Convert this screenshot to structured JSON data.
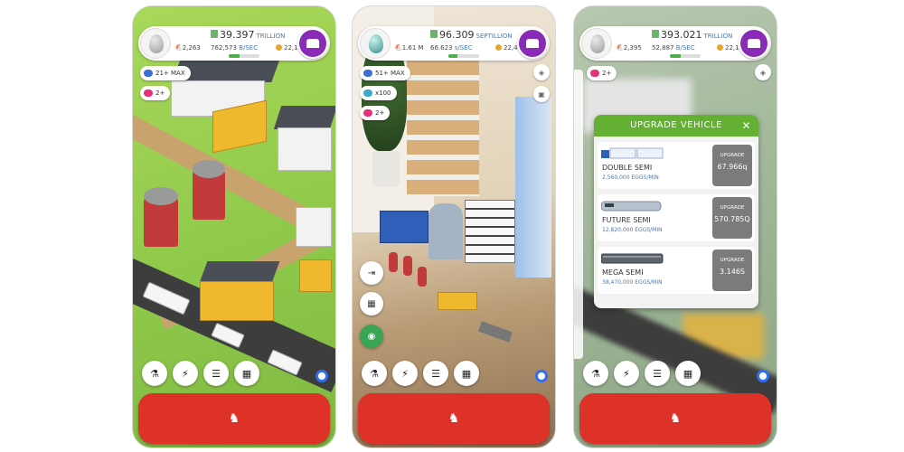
{
  "screens": [
    {
      "money": "39.397",
      "money_unit": "TRILLION",
      "chickens": "2,263",
      "rate": "762,573",
      "rate_unit": "B/SEC",
      "golden_eggs": "22,191",
      "progress": 0.35,
      "pills": [
        "21+ MAX",
        "2+"
      ]
    },
    {
      "money": "96.309",
      "money_unit": "SEPTILLION",
      "chickens": "1.61 M",
      "rate": "66.623",
      "rate_unit": "s/SEC",
      "golden_eggs": "22,479",
      "progress": 0.3,
      "pills": [
        "51+ MAX",
        "x100",
        "2+"
      ]
    },
    {
      "money": "393.021",
      "money_unit": "TRILLION",
      "chickens": "2,395",
      "rate": "52,887",
      "rate_unit": "B/SEC",
      "golden_eggs": "22,191",
      "progress": 0.35,
      "pills": [
        "2+"
      ]
    }
  ],
  "upgrade_panel": {
    "title": "UPGRADE VEHICLE",
    "close": "✕",
    "button_label": "UPGRADE",
    "vehicles": [
      {
        "name": "DOUBLE SEMI",
        "rate": "2,560,000 EGGS/MIN",
        "price": "67.966q"
      },
      {
        "name": "FUTURE SEMI",
        "rate": "12,820,000 EGGS/MIN",
        "price": "570.785Q"
      },
      {
        "name": "MEGA SEMI",
        "rate": "38,470,000 EGGS/MIN",
        "price": "3.146S"
      }
    ]
  },
  "icons": {
    "bottom_bar": [
      "flask-icon",
      "bolt-icon",
      "list-icon",
      "grid-icon"
    ],
    "hatch": "chicken-icon",
    "side_buttons": [
      "exit-icon",
      "grid-icon",
      "vr-headset-icon"
    ]
  },
  "colors": {
    "hatch_red": "#de3127",
    "shop_purple": "#8a2bb8",
    "panel_green": "#63b032",
    "blue_ring": "#2f6ef2"
  }
}
